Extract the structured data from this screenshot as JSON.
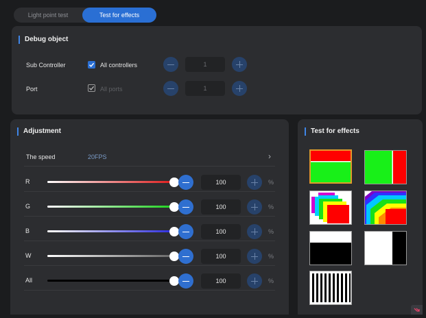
{
  "tabs": [
    "Light point test",
    "Test for effects"
  ],
  "debug": {
    "title": "Debug object",
    "sub_controller_label": "Sub Controller",
    "all_controllers_label": "All controllers",
    "sub_value": "1",
    "port_label": "Port",
    "all_ports_label": "All ports",
    "port_value": "1"
  },
  "adjust": {
    "title": "Adjustment",
    "speed_label": "The speed",
    "speed_value": "20FPS",
    "channels": [
      {
        "label": "R",
        "value": "100",
        "unit": "%",
        "level": 1.0,
        "color": "#e02020"
      },
      {
        "label": "G",
        "value": "100",
        "unit": "%",
        "level": 1.0,
        "color": "#22d322"
      },
      {
        "label": "B",
        "value": "100",
        "unit": "%",
        "level": 1.0,
        "color": "#3030e0"
      },
      {
        "label": "W",
        "value": "100",
        "unit": "%",
        "level": 1.0,
        "color": "#bdbdbd"
      },
      {
        "label": "All",
        "value": "100",
        "unit": "%",
        "level": 1.0,
        "color": "#000000"
      }
    ]
  },
  "effects": {
    "title": "Test for effects",
    "thumbnails": [
      "red-green-horizontal-split",
      "green-red-vertical-split",
      "rainbow-steps",
      "rainbow-diagonal",
      "white-black-horizontal",
      "white-black-vertical",
      "black-white-stripes"
    ],
    "selected_index": 0
  }
}
